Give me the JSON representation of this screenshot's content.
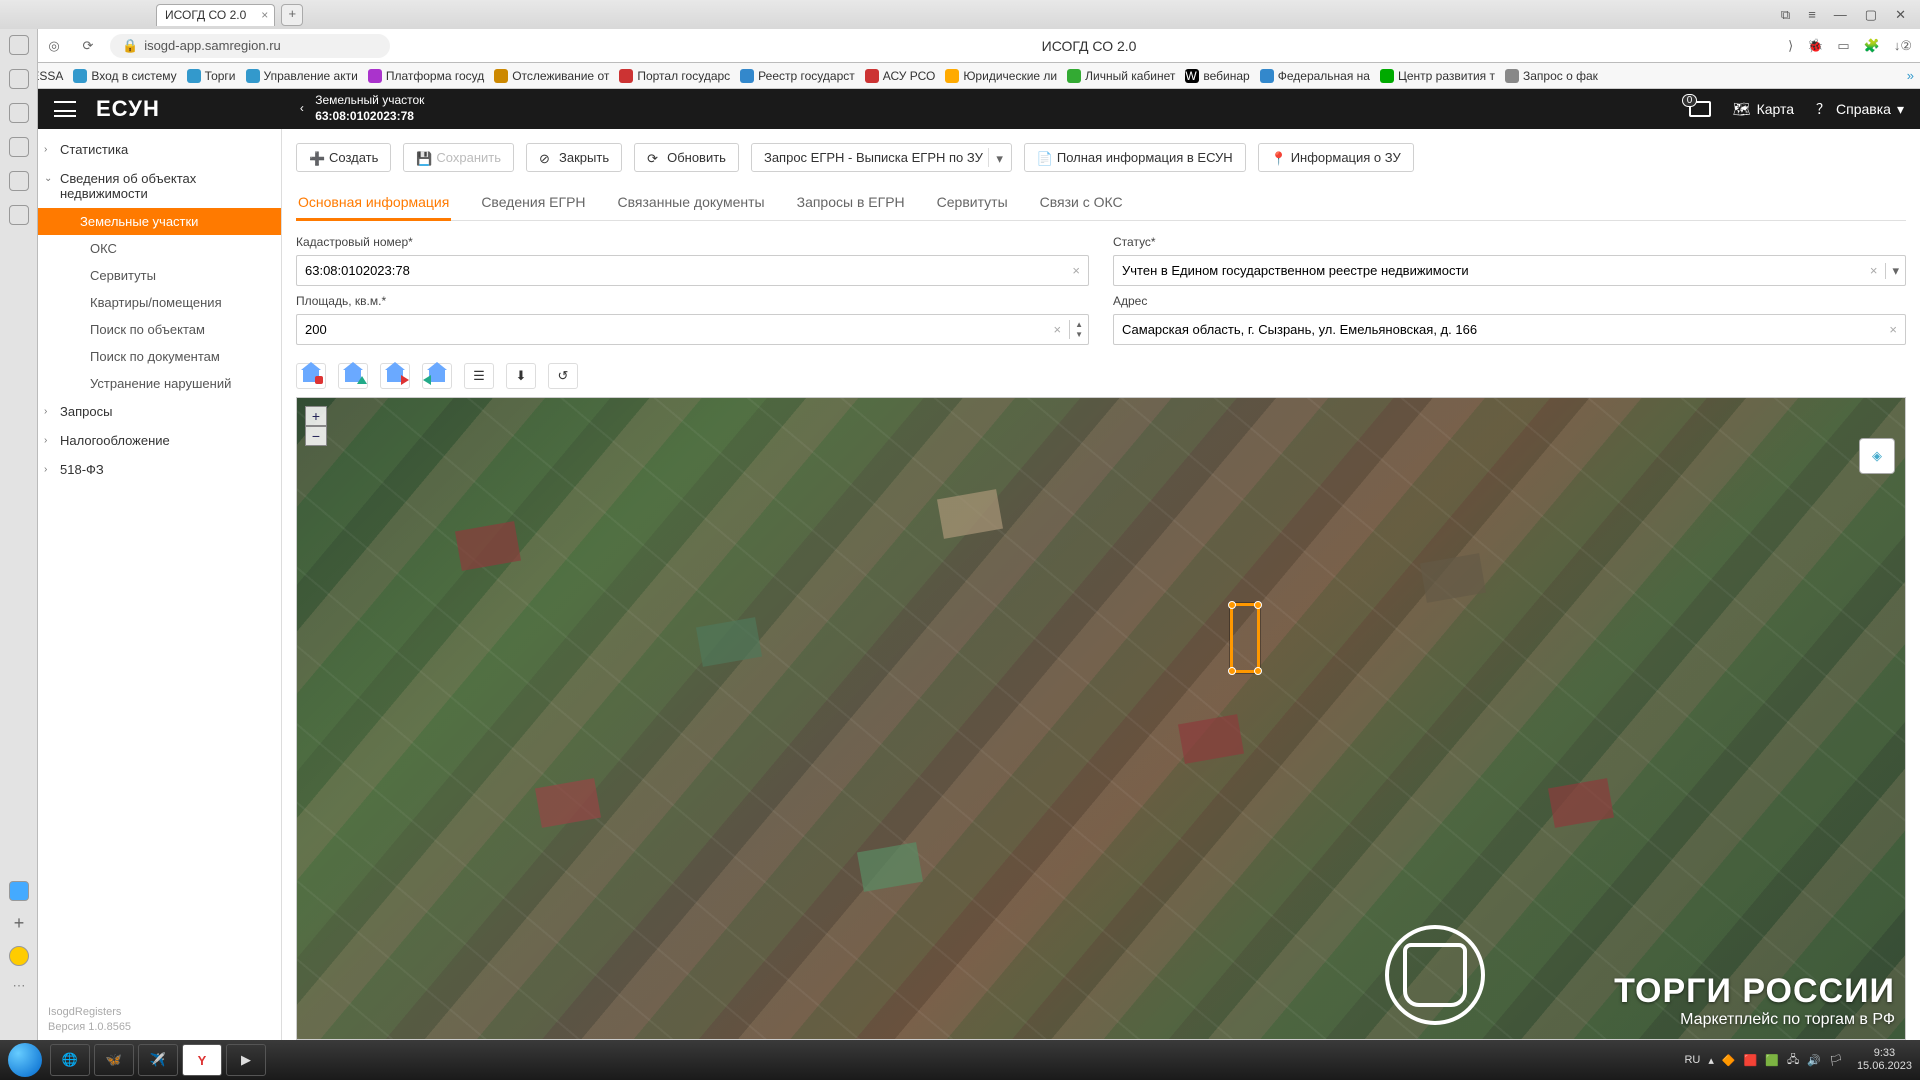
{
  "browser": {
    "tab_title": "ИСОГД СО 2.0",
    "page_title": "ИСОГД СО 2.0",
    "url": "isogd-app.samregion.ru",
    "bookmarks": [
      "TESSA",
      "Вход в систему",
      "Торги",
      "Управление акти",
      "Платформа госуд",
      "Отслеживание от",
      "Портал государс",
      "Реестр государст",
      "АСУ РСО",
      "Юридические ли",
      "Личный кабинет",
      "вебинар",
      "Федеральная на",
      "Центр развития т",
      "Запрос о фак"
    ]
  },
  "app": {
    "logo": "ЕСУН",
    "breadcrumb_line1": "Земельный участок",
    "breadcrumb_line2": "63:08:0102023:78",
    "mail_badge": "0",
    "map_label": "Карта",
    "help_label": "Справка"
  },
  "sidebar": {
    "items": [
      {
        "label": "Статистика",
        "expanded": false
      },
      {
        "label": "Сведения об объектах недвижимости",
        "expanded": true,
        "children": [
          {
            "label": "Земельные участки",
            "active": true
          },
          {
            "label": "ОКС"
          },
          {
            "label": "Сервитуты"
          },
          {
            "label": "Квартиры/помещения"
          },
          {
            "label": "Поиск по объектам"
          },
          {
            "label": "Поиск по документам"
          },
          {
            "label": "Устранение нарушений"
          }
        ]
      },
      {
        "label": "Запросы",
        "expanded": false
      },
      {
        "label": "Налогообложение",
        "expanded": false
      },
      {
        "label": "518-ФЗ",
        "expanded": false
      }
    ],
    "footer_line1": "IsogdRegisters",
    "footer_line2": "Версия 1.0.8565"
  },
  "toolbar": {
    "create": "Создать",
    "save": "Сохранить",
    "close": "Закрыть",
    "refresh": "Обновить",
    "egrn_request": "Запрос ЕГРН - Выписка ЕГРН по ЗУ",
    "full_info": "Полная информация в ЕСУН",
    "zu_info": "Информация о ЗУ"
  },
  "tabs": [
    "Основная информация",
    "Сведения ЕГРН",
    "Связанные документы",
    "Запросы в ЕГРН",
    "Сервитуты",
    "Связи с ОКС"
  ],
  "form": {
    "cadastral_label": "Кадастровый номер*",
    "cadastral_value": "63:08:0102023:78",
    "status_label": "Статус*",
    "status_value": "Учтен в Едином государственном реестре недвижимости",
    "area_label": "Площадь, кв.м.*",
    "area_value": "200",
    "address_label": "Адрес",
    "address_value": "Самарская область, г. Сызрань, ул. Емельяновская, д. 166"
  },
  "watermark": {
    "title": "ТОРГИ РОССИИ",
    "subtitle": "Маркетплейс по торгам в РФ"
  },
  "taskbar": {
    "lang": "RU",
    "time": "9:33",
    "date": "15.06.2023"
  }
}
